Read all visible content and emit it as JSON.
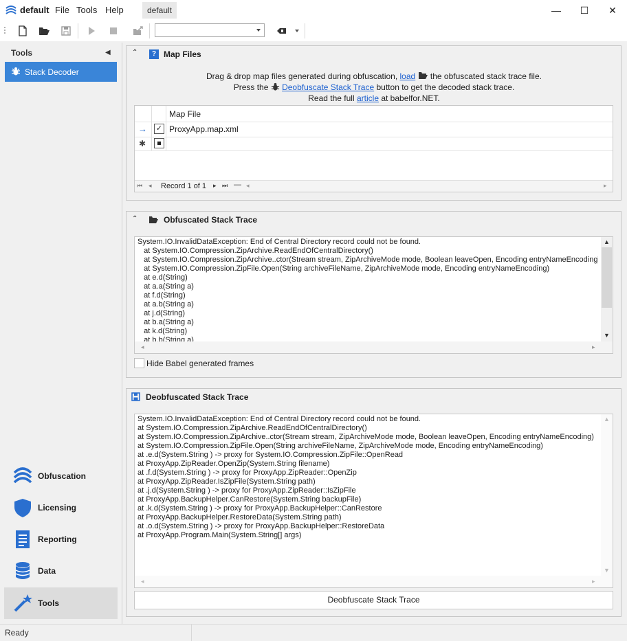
{
  "app": {
    "name": "default",
    "menu": [
      "File",
      "Tools",
      "Help"
    ],
    "doc_tab": "default"
  },
  "window_controls": {
    "minimize": "—",
    "maximize": "☐",
    "close": "✕"
  },
  "toolbar": {
    "combo_value": "",
    "icons": [
      "new-file-icon",
      "open-folder-icon",
      "save-icon",
      "run-icon",
      "stop-icon",
      "export-icon",
      "eraser-icon"
    ]
  },
  "left_panel": {
    "header": "Tools",
    "items": [
      {
        "label": "Stack Decoder",
        "icon": "bug-icon"
      }
    ],
    "nav": [
      {
        "label": "Obfuscation",
        "icon": "babel-logo-icon"
      },
      {
        "label": "Licensing",
        "icon": "shield-icon"
      },
      {
        "label": "Reporting",
        "icon": "document-icon"
      },
      {
        "label": "Data",
        "icon": "database-icon"
      },
      {
        "label": "Tools",
        "icon": "magic-wand-icon"
      }
    ]
  },
  "map_files": {
    "title": "Map Files",
    "line1_pre": "Drag & drop map files generated during obfuscation,",
    "line1_link": "load",
    "line1_post": "the obfuscated stack trace file.",
    "line2_pre": "Press the",
    "line2_link": "Deobfuscate Stack Trace",
    "line2_post": "button to get the decoded stack trace.",
    "line3_pre": "Read the full",
    "line3_link": "article",
    "line3_post": "at babelfor.NET.",
    "grid_header": "Map File",
    "rows": [
      {
        "checked": "✓",
        "file": "ProxyApp.map.xml"
      }
    ],
    "record_text": "Record 1 of 1"
  },
  "obfuscated": {
    "title": "Obfuscated Stack Trace",
    "lines": [
      "System.IO.InvalidDataException: End of Central Directory record could not be found.",
      "   at System.IO.Compression.ZipArchive.ReadEndOfCentralDirectory()",
      "   at System.IO.Compression.ZipArchive..ctor(Stream stream, ZipArchiveMode mode, Boolean leaveOpen, Encoding entryNameEncoding)",
      "   at System.IO.Compression.ZipFile.Open(String archiveFileName, ZipArchiveMode mode, Encoding entryNameEncoding)",
      "   at e.d(String)",
      "   at a.a(String a)",
      "   at f.d(String)",
      "   at a.b(String a)",
      "   at j.d(String)",
      "   at b.a(String a)",
      "   at k.d(String)",
      "   at b.b(String a)"
    ],
    "hide_frames_label": "Hide Babel generated frames"
  },
  "deobfuscated": {
    "title": "Deobfuscated Stack Trace",
    "lines": [
      "System.IO.InvalidDataException: End of Central Directory record could not be found.",
      "at System.IO.Compression.ZipArchive.ReadEndOfCentralDirectory()",
      "at System.IO.Compression.ZipArchive..ctor(Stream stream, ZipArchiveMode mode, Boolean leaveOpen, Encoding entryNameEncoding)",
      "at System.IO.Compression.ZipFile.Open(String archiveFileName, ZipArchiveMode mode, Encoding entryNameEncoding)",
      "at .e.d(System.String ) -> proxy for System.IO.Compression.ZipFile::OpenRead",
      "at ProxyApp.ZipReader.OpenZip(System.String filename)",
      "at .f.d(System.String ) -> proxy for ProxyApp.ZipReader::OpenZip",
      "at ProxyApp.ZipReader.IsZipFile(System.String path)",
      "at .j.d(System.String ) -> proxy for ProxyApp.ZipReader::IsZipFile",
      "at ProxyApp.BackupHelper.CanRestore(System.String backupFile)",
      "at .k.d(System.String ) -> proxy for ProxyApp.BackupHelper::CanRestore",
      "at ProxyApp.BackupHelper.RestoreData(System.String path)",
      "at .o.d(System.String ) -> proxy for ProxyApp.BackupHelper::RestoreData",
      "at ProxyApp.Program.Main(System.String[] args)"
    ],
    "button_label": "Deobfuscate Stack Trace"
  },
  "status": {
    "text": "Ready"
  },
  "colors": {
    "accent": "#3a85d8",
    "link": "#1b5fcf",
    "icon_blue": "#2a6fcf"
  }
}
